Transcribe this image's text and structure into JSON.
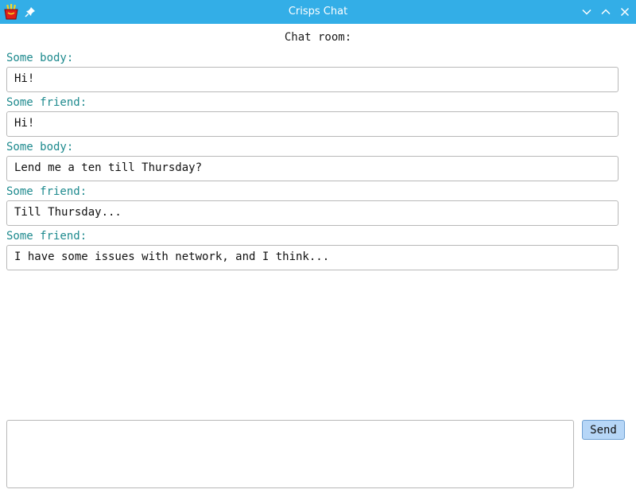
{
  "window": {
    "title": "Crisps Chat",
    "titlebar_color": "#33aee7",
    "icons": {
      "app": "fries-bucket-icon",
      "pin": "pin-icon",
      "minimize": "chevron-down-icon",
      "maximize": "chevron-up-icon",
      "close": "close-icon"
    }
  },
  "chat": {
    "heading": "Chat room:",
    "sender_color": "#1e8a8e",
    "messages": [
      {
        "sender": "Some body:",
        "text": "Hi!"
      },
      {
        "sender": "Some friend:",
        "text": "Hi!"
      },
      {
        "sender": "Some body:",
        "text": "Lend me a ten till Thursday?"
      },
      {
        "sender": "Some friend:",
        "text": "Till Thursday..."
      },
      {
        "sender": "Some friend:",
        "text": "I have some issues with network, and I think..."
      }
    ]
  },
  "composer": {
    "value": "",
    "send_label": "Send"
  }
}
